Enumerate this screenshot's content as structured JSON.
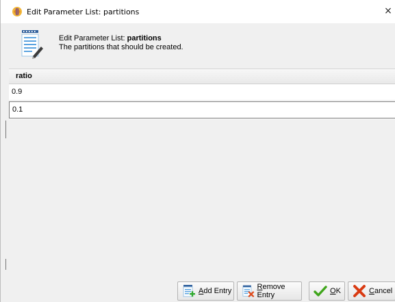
{
  "window": {
    "title": "Edit Parameter List: partitions",
    "close_glyph": "×"
  },
  "header": {
    "title_prefix": "Edit Parameter List: ",
    "title_name": "partitions",
    "description": "The partitions that should be created.",
    "icon": "notepad-edit-icon"
  },
  "table": {
    "column_header": "ratio",
    "rows": [
      "0.9",
      "0.1"
    ]
  },
  "buttons": {
    "add": {
      "mnemonic": "A",
      "rest": "dd Entry",
      "icon": "add-entry-icon"
    },
    "remove": {
      "mnemonic": "R",
      "rest": "emove Entry",
      "icon": "remove-entry-icon"
    },
    "ok": {
      "mnemonic": "O",
      "rest": "K",
      "icon": "checkmark-icon",
      "icon_color": "#3fa51b"
    },
    "cancel": {
      "mnemonic": "C",
      "rest": "ancel",
      "icon": "cancel-x-icon",
      "icon_color": "#d93a12"
    }
  }
}
